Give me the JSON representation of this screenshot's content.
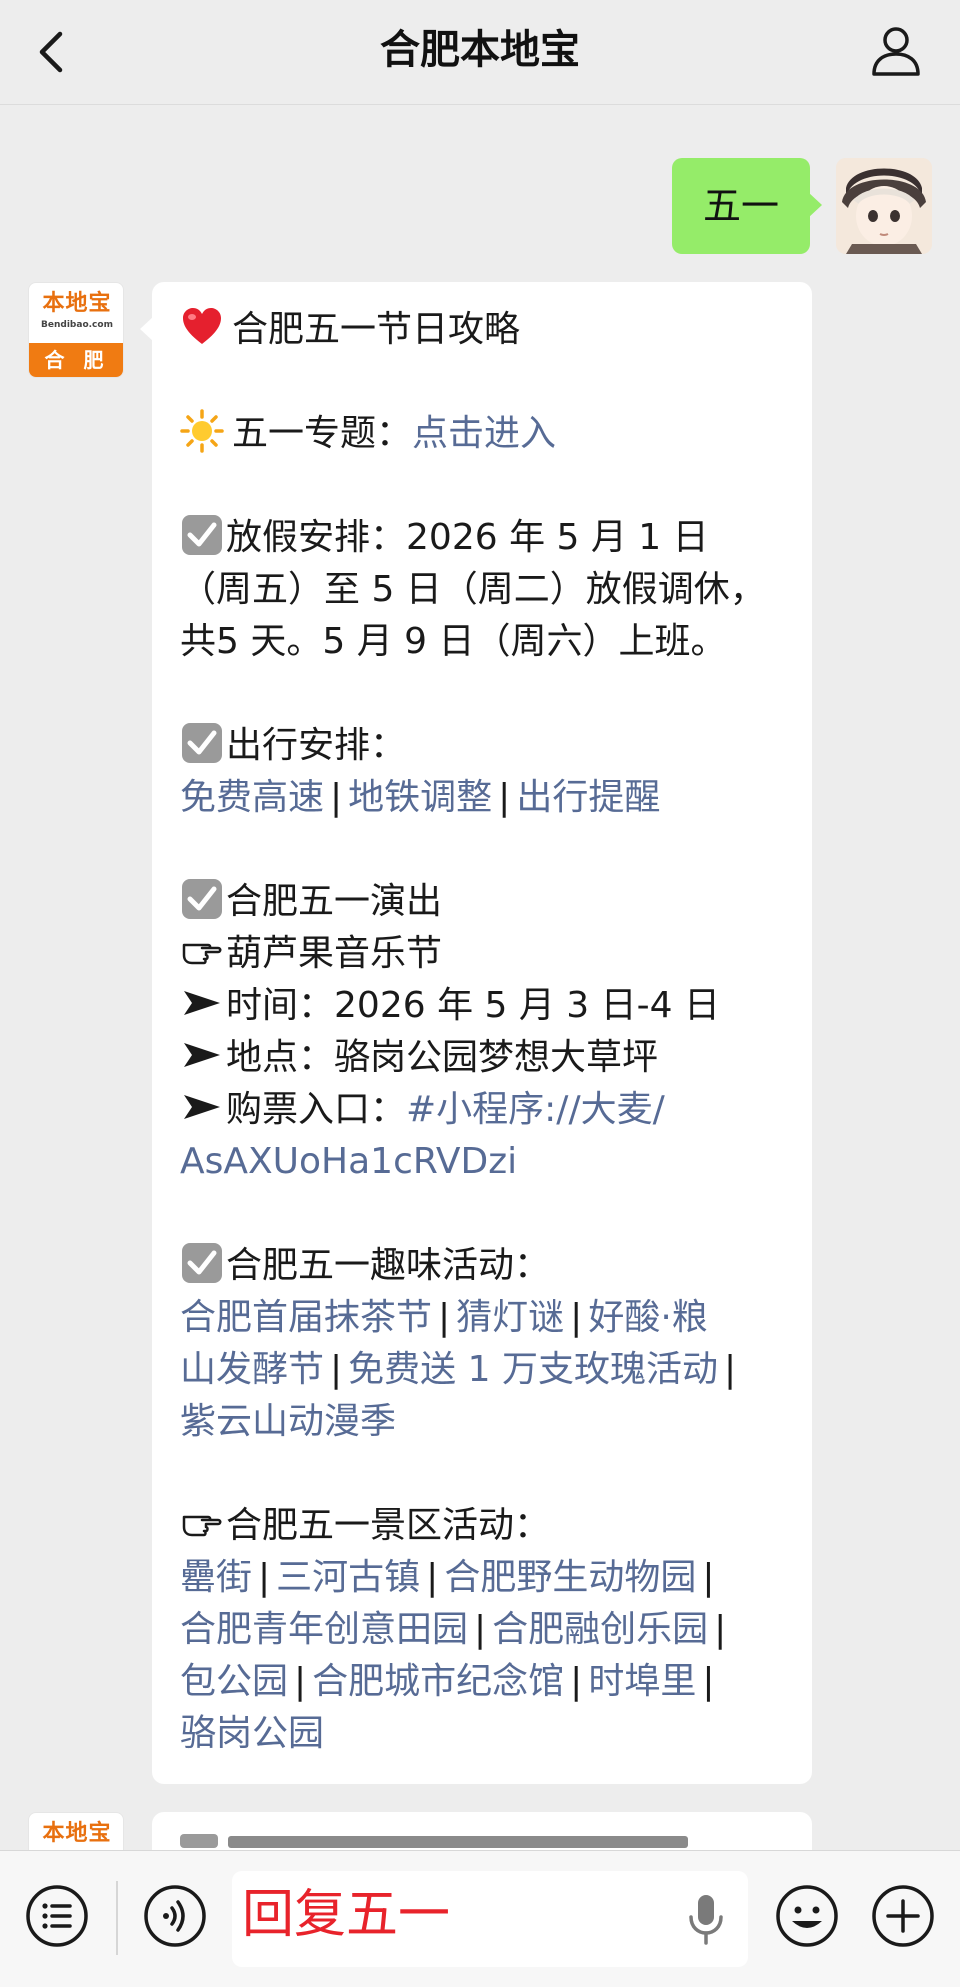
{
  "header": {
    "title": "合肥本地宝"
  },
  "user_message": {
    "text": "五一"
  },
  "bot_avatar": {
    "brand": "本地宝",
    "site": "Bendibao.com",
    "city": "合 肥"
  },
  "bot_message": {
    "title": "合肥五一节日攻略",
    "topic_label": "五一专题：",
    "topic_link": "点击进入",
    "holiday_label": "放假安排：",
    "holiday_text_1": "2026 年 5 月 1 日",
    "holiday_text_2": "（周五）至 5 日（周二）放假调休，",
    "holiday_text_3": "共5 天。5 月 9 日（周六）上班。",
    "travel_label": "出行安排：",
    "travel_links": [
      "免费高速",
      "地铁调整",
      "出行提醒"
    ],
    "show_label": "合肥五一演出",
    "show_name": "葫芦果音乐节",
    "show_time_label": "时间：",
    "show_time": "2026 年 5 月 3 日-4 日",
    "show_place_label": "地点：",
    "show_place": "骆岗公园梦想大草坪",
    "show_ticket_label": "购票入口：",
    "show_ticket_link_1": "#小程序://大麦/",
    "show_ticket_link_2": "AsAXUoHa1cRVDzi",
    "fun_label": "合肥五一趣味活动：",
    "fun_links": [
      "合肥首届抹茶节",
      "猜灯谜",
      "好酸·粮",
      "山发酵节",
      "免费送 1 万支玫瑰活动",
      "紫云山动漫季"
    ],
    "scenic_label": "合肥五一景区活动：",
    "scenic_links": [
      "罍街",
      "三河古镇",
      "合肥野生动物园",
      "合肥青年创意田园",
      "合肥融创乐园",
      "包公园",
      "合肥城市纪念馆",
      "时埠里",
      "骆岗公园"
    ]
  },
  "bottom_bar": {
    "input_value": "回复五一"
  },
  "icons": [
    "chevron-left-icon",
    "user-profile-icon",
    "menu-list-icon",
    "voice-icon",
    "mic-icon",
    "emoji-icon",
    "plus-icon",
    "heart-icon",
    "sun-icon",
    "checkbox-icon",
    "pointing-hand-icon",
    "arrow-icon"
  ],
  "colors": {
    "background": "#ededed",
    "user_bubble": "#95ec69",
    "link": "#576b95",
    "brand_orange": "#f07b12",
    "input_text": "#e8232b"
  }
}
